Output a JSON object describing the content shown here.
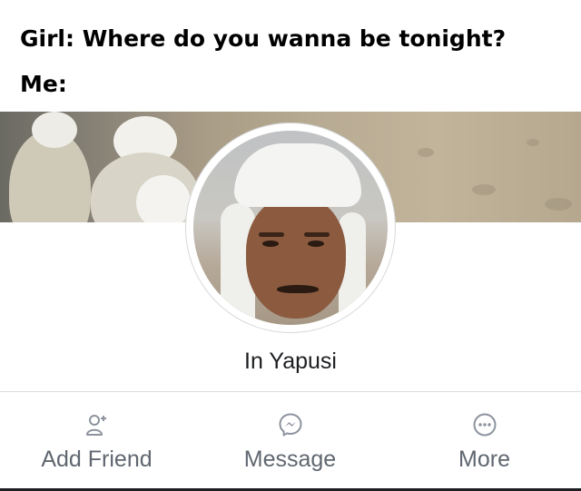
{
  "caption": {
    "line1": "Girl: Where do you wanna be tonight?",
    "line2": "Me:"
  },
  "profile": {
    "name": "In Yapusi"
  },
  "actions": [
    {
      "label": "Add Friend",
      "icon": "add-friend-icon"
    },
    {
      "label": "Message",
      "icon": "messenger-icon"
    },
    {
      "label": "More",
      "icon": "more-icon"
    }
  ],
  "colors": {
    "text": "#1c1e21",
    "action_text": "#606770",
    "icon": "#8d949e",
    "divider": "#dadde1"
  }
}
